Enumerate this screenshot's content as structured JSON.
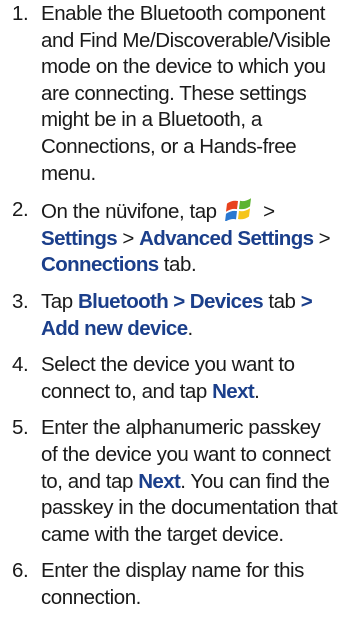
{
  "steps": [
    {
      "number": "1.",
      "text": "Enable the Bluetooth component and Find Me/Discoverable/Visible mode on the device to which you are connecting. These settings might be in a Bluetooth, a Connections, or a Hands-free menu."
    },
    {
      "number": "2.",
      "parts": [
        "On the nüvifone, tap ",
        " > ",
        "Settings",
        " > ",
        "Advanced Settings",
        " > ",
        "Connections",
        " tab."
      ],
      "icon": "windows-start-icon"
    },
    {
      "number": "3.",
      "parts": [
        "Tap ",
        "Bluetooth > Devices",
        " tab ",
        ">",
        " ",
        "Add new device",
        "."
      ]
    },
    {
      "number": "4.",
      "parts": [
        "Select the device you want to connect to, and tap ",
        "Next",
        "."
      ]
    },
    {
      "number": "5.",
      "parts": [
        "Enter the alphanumeric passkey of the device you want to connect to, and tap ",
        "Next",
        ". You can find the passkey in the documentation that came with the target device."
      ]
    },
    {
      "number": "6.",
      "text": "Enter the display name for this connection."
    }
  ],
  "colors": {
    "text": "#1a1a1a",
    "bold_link": "#1b3f8b"
  }
}
